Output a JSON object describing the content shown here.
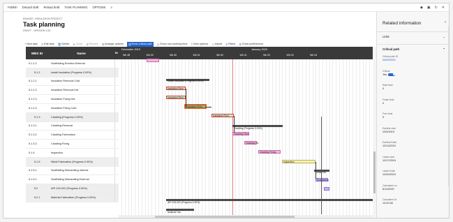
{
  "topbar": {
    "items": [
      "Publish",
      "Discard draft",
      "Reload draft",
      "TASK PLANNING",
      "OPTIONS"
    ],
    "search_icon": "search-icon",
    "win_icons": [
      "diamond-icon",
      "office-icon",
      "refresh-icon",
      "close-icon"
    ]
  },
  "header": {
    "breadcrumb": "E000000 : INSULATION PROJECT",
    "title": "Task planning",
    "subtitle": "DRAFT - VERSION 4.00"
  },
  "toolbar": {
    "items": [
      {
        "label": "New task",
        "icon": "+"
      },
      {
        "label": "Edit task",
        "icon": "✎"
      },
      {
        "label": "Delete",
        "icon": "🗑"
      },
      {
        "label": "Close",
        "icon": "✕"
      },
      {
        "label": "Reopen",
        "icon": "↺"
      },
      {
        "label": "Arrange options",
        "icon": "⇅"
      },
      {
        "label": "Show critical path",
        "icon": "⇶"
      },
      {
        "label": "Show non-working time",
        "icon": "◷"
      },
      {
        "label": "View options",
        "icon": "≡"
      },
      {
        "label": "Import",
        "icon": "⇩"
      },
      {
        "label": "Filters",
        "icon": "⚲"
      },
      {
        "label": "Chart preferences",
        "icon": "⚙"
      }
    ]
  },
  "grid": {
    "headers": [
      "WBS ID",
      "Name",
      "Re"
    ],
    "rows": [
      {
        "wbs": "5.1.1.2",
        "name": "Scaffolding Erection External",
        "sum": false
      },
      {
        "wbs": "5.1.2",
        "name": "Install Insulation (Progress 0.00%)",
        "sum": true
      },
      {
        "wbs": "5.1.2.1",
        "name": "Insulation Removal Cold",
        "sum": false
      },
      {
        "wbs": "5.1.2.2",
        "name": "Insulation Removal Hot",
        "sum": false
      },
      {
        "wbs": "5.1.2.3",
        "name": "Insulation Fixing Hot",
        "sum": false
      },
      {
        "wbs": "5.1.2.4",
        "name": "Insulation Fixing Cold",
        "sum": false
      },
      {
        "wbs": "5.1.3",
        "name": "Cladding (Progress 0.00%)",
        "sum": true
      },
      {
        "wbs": "5.1.3.1",
        "name": "Cladding Removal",
        "sum": false
      },
      {
        "wbs": "5.1.3.2",
        "name": "Cladding Fabrication",
        "sum": false
      },
      {
        "wbs": "5.1.3.3",
        "name": "Cladding Fixing",
        "sum": false
      },
      {
        "wbs": "5.1.4",
        "name": "Inspection",
        "sum": false
      },
      {
        "wbs": "5.1.5",
        "name": "Metal Fabrication (Progress 0.00%)",
        "sum": true
      },
      {
        "wbs": "5.1.5.1",
        "name": "Scaffolding Dismantling Internal",
        "sum": false
      },
      {
        "wbs": "5.1.5.2",
        "name": "Scaffolding Dismantling External",
        "sum": false
      },
      {
        "wbs": "5.2",
        "name": "WP-100-002 (Progress 0.00%)",
        "sum": true
      },
      {
        "wbs": "5.2.1",
        "name": "Material Fabrication (Progress 0.00%)",
        "sum": true
      }
    ]
  },
  "gantt": {
    "months": [
      {
        "label": "December 2019"
      },
      {
        "label": "January 2020"
      }
    ],
    "weeks": [
      "Wk 48",
      "Wk 49",
      "Wk 50",
      "Wk 51",
      "Wk 52",
      "Wk 01",
      "Wk 02",
      "Wk 03",
      "Wk 04"
    ],
    "bar_labels": {
      "install_insulation": "Install Insulation (Progress 0.00%)",
      "removal_cold": "Insulation Rem",
      "removal_hot": "Insulation Rem",
      "fixing_hot": "Insulation Fixin",
      "fixing_cold": "Insulation Fixin",
      "cladding": "Cladding (Progress 0.00%)",
      "cladding_removal": "Cladding Rem",
      "cladding_fab": "Cladding Fa",
      "cladding_fixing": "Cladding Fixing",
      "inspection": "Inspection",
      "metal_fab": "Metal Fab",
      "scaff_int": "Scaffolding",
      "wp": "WP-100-002 (Progress 0.00%)",
      "material": "Material Fab"
    }
  },
  "side": {
    "title": "Related information",
    "sections": [
      "Links",
      "Critical path"
    ],
    "fields": [
      {
        "label": "Critical path ID",
        "value": "000000001",
        "type": "link"
      },
      {
        "label": "Critical",
        "value": "Yes",
        "type": "toggle"
      },
      {
        "label": "Start float",
        "value": "0",
        "type": "text"
      },
      {
        "label": "Finish float",
        "value": "0",
        "type": "text"
      },
      {
        "label": "Free float",
        "value": "0",
        "type": "text"
      },
      {
        "label": "Earliest start",
        "value": "12/9/2019",
        "type": "text"
      },
      {
        "label": "Earliest finish",
        "value": "12/11/2019",
        "type": "text"
      },
      {
        "label": "Latest start",
        "value": "12/17/2019",
        "type": "text"
      },
      {
        "label": "Latest finish",
        "value": "12/20/2019",
        "type": "text"
      },
      {
        "label": "Calculated on",
        "value": "6/11/2020",
        "type": "text"
      },
      {
        "label": "Calculated at",
        "value": "14:20:46",
        "type": "text"
      }
    ]
  },
  "colors": {
    "accent": "#2266cc",
    "header_dark": "#3a3a3a",
    "critical_border": "#d23a3a",
    "pink_task": "#f4b8e0"
  }
}
